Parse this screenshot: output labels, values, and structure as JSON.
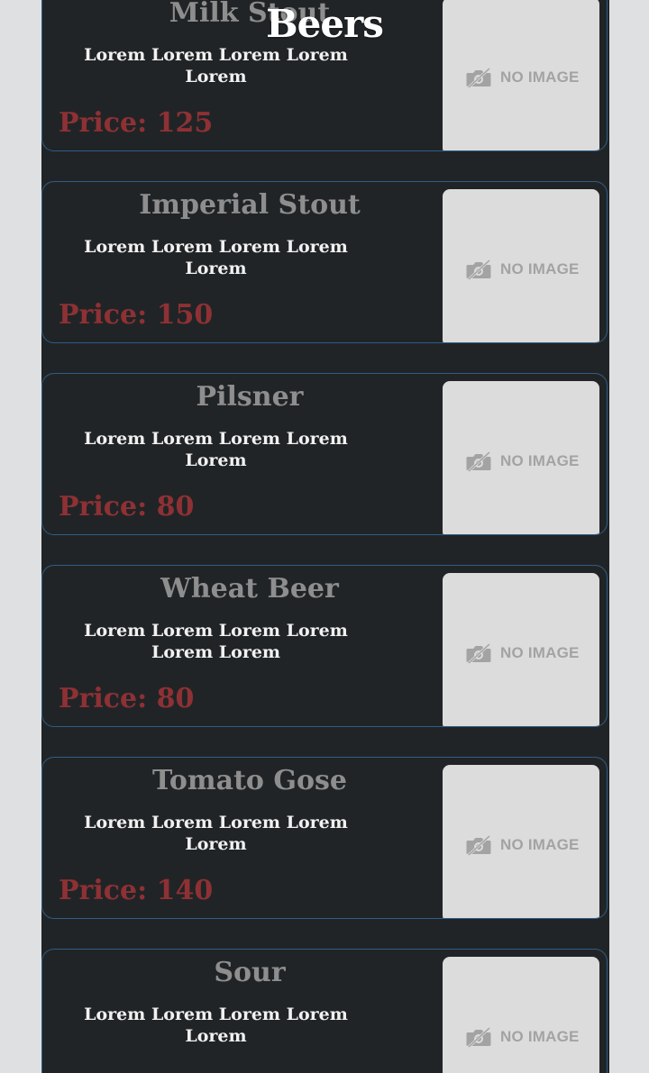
{
  "header": {
    "title": "Beers"
  },
  "placeholder": {
    "text": "NO IMAGE",
    "icon": "camera-off-icon"
  },
  "colors": {
    "page_background": "#dfe0e2",
    "card_background": "#212426",
    "card_border": "#2f5d86",
    "name": "#8e8e8e",
    "description": "#f1f1f1",
    "price": "#8e3134",
    "placeholder_background": "#dcdcdc"
  },
  "items": [
    {
      "name": "Milk Stout",
      "description": "Lorem Lorem Lorem Lorem Lorem",
      "price": "Price: 125"
    },
    {
      "name": "Imperial Stout",
      "description": "Lorem Lorem Lorem Lorem Lorem",
      "price": "Price: 150"
    },
    {
      "name": "Pilsner",
      "description": "Lorem Lorem Lorem Lorem Lorem",
      "price": "Price: 80"
    },
    {
      "name": "Wheat Beer",
      "description": "Lorem Lorem Lorem Lorem Lorem Lorem",
      "price": "Price: 80"
    },
    {
      "name": "Tomato Gose",
      "description": "Lorem Lorem Lorem Lorem Lorem",
      "price": "Price: 140"
    },
    {
      "name": "Sour",
      "description": "Lorem Lorem Lorem Lorem Lorem"
    }
  ]
}
